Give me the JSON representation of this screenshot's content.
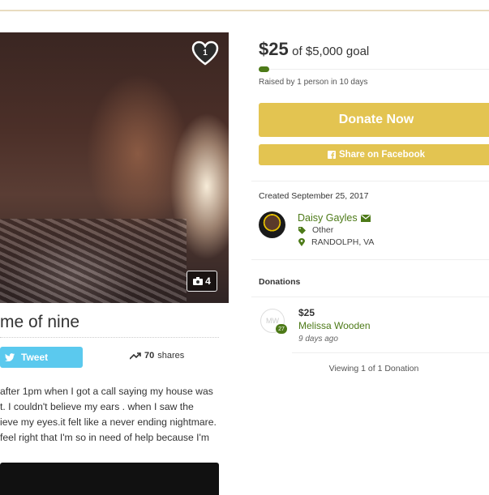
{
  "photo": {
    "heart_count": "1",
    "photo_count": "4"
  },
  "campaign": {
    "title": "me of nine",
    "tweet_label": "Tweet",
    "shares_count": "70",
    "shares_label": "shares",
    "story_lines": [
      " after 1pm when I got a call saying my house was",
      "t. I couldn't believe my ears . when I saw the",
      "ieve my eyes.it felt like a never ending nightmare.",
      " feel right that I'm so in need of help because I'm"
    ]
  },
  "sidebar": {
    "amount_raised": "$25",
    "goal_text": "of $5,000 goal",
    "progress_fraction": 0.005,
    "raised_by": "Raised by 1 person in 10 days",
    "donate_label": "Donate Now",
    "facebook_label": "Share on Facebook",
    "created": "Created September 25, 2017",
    "organizer": {
      "name": "Daisy Gayles",
      "category": "Other",
      "location": "RANDOLPH, VA"
    },
    "donations_heading": "Donations",
    "donation": {
      "initials": "MW",
      "days_badge": "27",
      "amount": "$25",
      "name": "Melissa Wooden",
      "time": "9 days ago"
    },
    "viewing": "Viewing 1 of 1 Donation"
  },
  "colors": {
    "accent_gold": "#e3c451",
    "accent_green": "#4d7a18",
    "twitter_blue": "#5bc9ee"
  }
}
